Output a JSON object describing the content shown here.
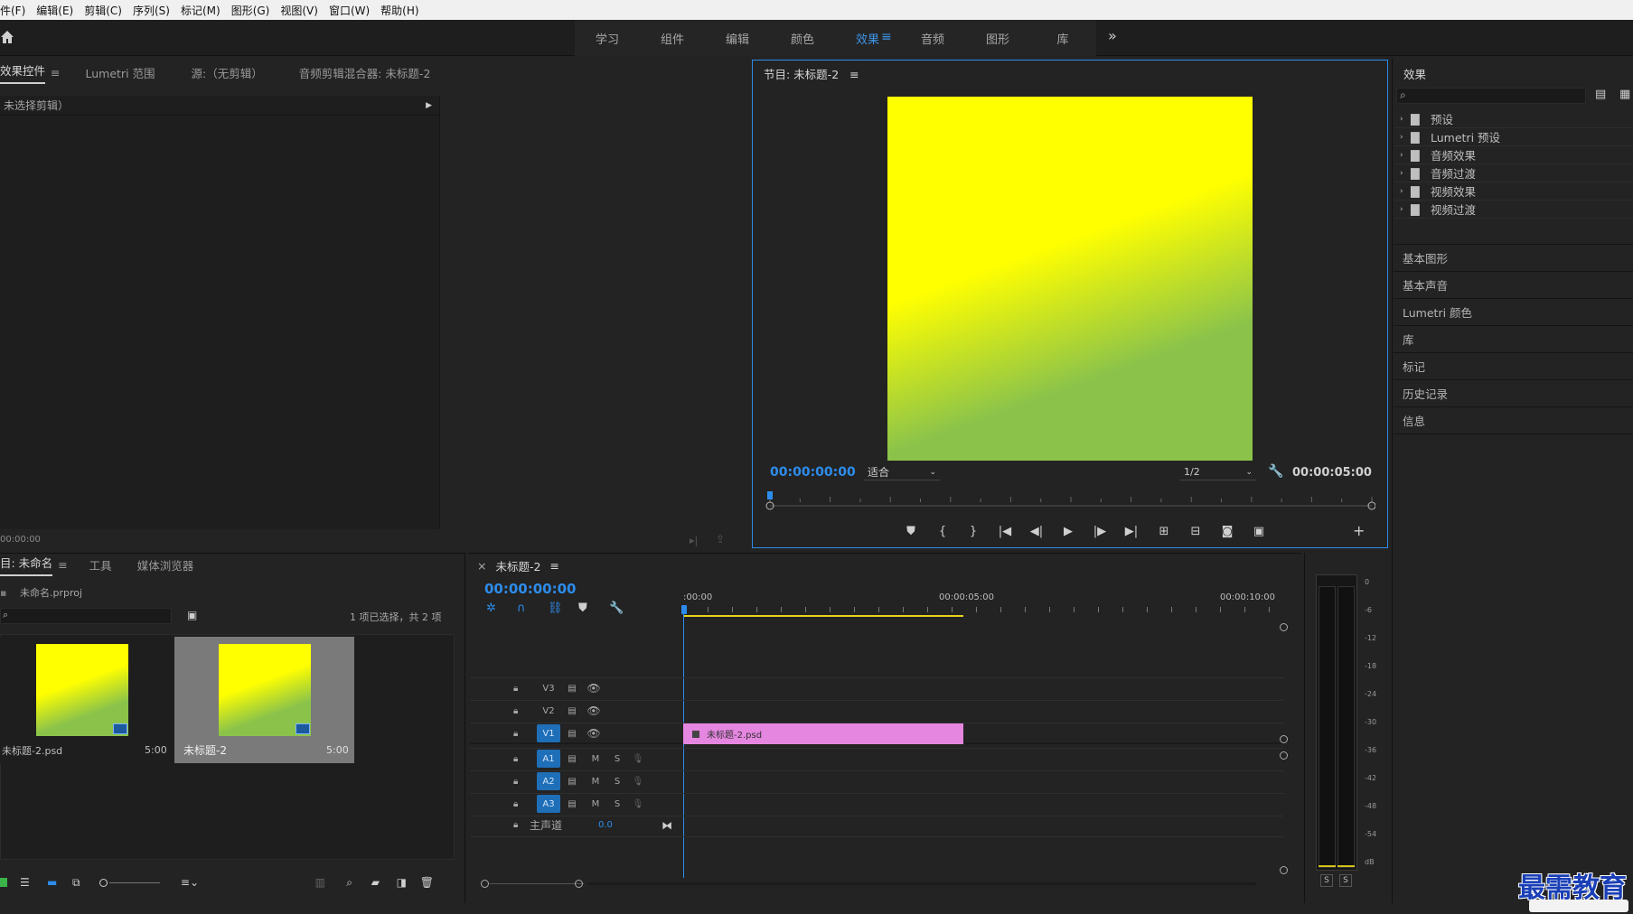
{
  "menu": [
    "件(F)",
    "编辑(E)",
    "剪辑(C)",
    "序列(S)",
    "标记(M)",
    "图形(G)",
    "视图(V)",
    "窗口(W)",
    "帮助(H)"
  ],
  "workspaces": {
    "tabs": [
      "学习",
      "组件",
      "编辑",
      "颜色",
      "效果",
      "音频",
      "图形",
      "库"
    ],
    "active": "效果",
    "more": "»"
  },
  "source_panel": {
    "tabs": [
      "效果控件",
      "Lumetri 范围",
      "源:（无剪辑）",
      "音频剪辑混合器: 未标题-2"
    ],
    "active_tab": "效果控件",
    "no_clip": "未选择剪辑）",
    "timecode": "00:00:00"
  },
  "program": {
    "title": "节目: 未标题-2",
    "timecode": "00:00:00:00",
    "fit": "适合",
    "resolution": "1/2",
    "duration": "00:00:05:00",
    "gradient": {
      "top": "#ffff00",
      "bottom": "#8bc34a"
    }
  },
  "effects": {
    "title": "效果",
    "folders": [
      "预设",
      "Lumetri 预设",
      "音频效果",
      "音频过渡",
      "视频效果",
      "视频过渡"
    ],
    "sections": [
      "基本图形",
      "基本声音",
      "Lumetri 颜色",
      "库",
      "标记",
      "历史记录",
      "信息"
    ]
  },
  "project": {
    "tabs": [
      "目: 未命名",
      "工具",
      "媒体浏览器"
    ],
    "active_tab": "目: 未命名",
    "file": "未命名.prproj",
    "selection_info": "1 项已选择，共 2 项",
    "items": [
      {
        "name": "未标题-2.psd",
        "duration": "5:00",
        "selected": false
      },
      {
        "name": "未标题-2",
        "duration": "5:00",
        "selected": true
      }
    ]
  },
  "timeline": {
    "title": "未标题-2",
    "close": "×",
    "timecode": "00:00:00:00",
    "ruler": [
      ":00:00",
      "00:00:05:00",
      "00:00:10:00"
    ],
    "video_tracks": [
      "V3",
      "V2",
      "V1"
    ],
    "audio_tracks": [
      "A1",
      "A2",
      "A3"
    ],
    "master": "主声道",
    "master_value": "0.0",
    "clip": {
      "name": "未标题-2.psd",
      "color": "#e586e0"
    },
    "toggle_m": "M",
    "toggle_s": "S"
  },
  "meter": {
    "scale": [
      "0",
      "-6",
      "-12",
      "-18",
      "-24",
      "-30",
      "-36",
      "-42",
      "-48",
      "-54",
      "dB"
    ],
    "solo": [
      "S",
      "S"
    ]
  },
  "watermark": "最需教育",
  "colors": {
    "accent": "#2d8ceb",
    "panel": "#232323",
    "menubar": "#f0f0f0"
  }
}
